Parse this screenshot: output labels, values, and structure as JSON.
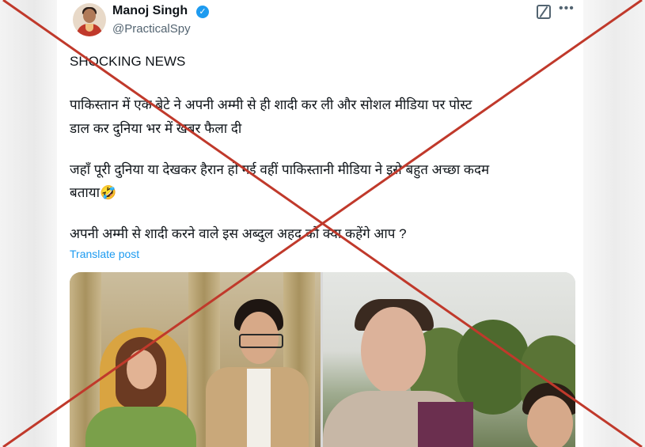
{
  "post": {
    "author_name": "Manoj Singh",
    "author_handle": "@PracticalSpy",
    "verified_icon": "verified-badge-icon",
    "lines": [
      "SHOCKING NEWS",
      "पाकिस्तान में एक बेटे ने अपनी अम्मी से ही शादी कर ली और सोशल मीडिया पर पोस्ट",
      "डाल कर दुनिया भर में खबर फैला दी",
      "जहाँ पूरी दुनिया या देखकर हैरान हो गई वहीं पाकिस्तानी मीडिया ने इसे बहुत अच्छा कदम",
      "बताया🤣",
      "अपनी अम्मी से शादी करने वाले इस अब्दुल अहद को क्या कहेंगे आप ?"
    ],
    "translate_label": "Translate post",
    "more_icon_text": "•••"
  },
  "overlay": {
    "color": "#c0392b",
    "type": "cross-out"
  },
  "colors": {
    "link": "#1d9bf0",
    "text": "#0f1419",
    "secondary": "#536471"
  }
}
